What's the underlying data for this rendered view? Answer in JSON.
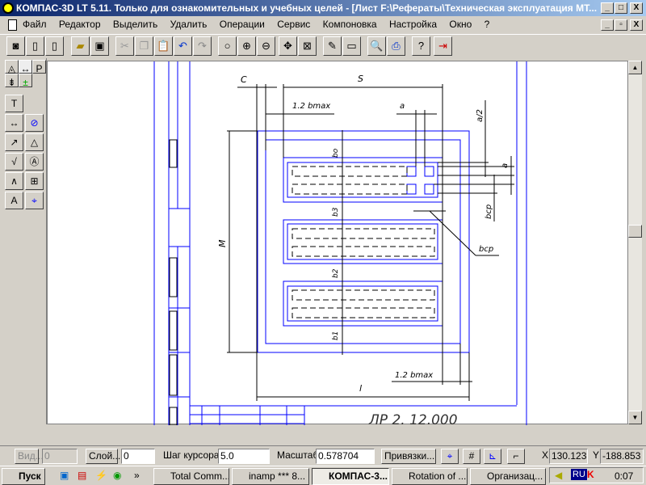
{
  "window": {
    "title": "КОМПАС-3D LT 5.11. Только для ознакомительных и учебных целей - [Лист F:\\Рефераты\\Техническая эксплуатация МТ...",
    "minimize": "_",
    "maximize": "□",
    "close": "X",
    "doc_restore": "▫"
  },
  "menu": [
    "Файл",
    "Редактор",
    "Выделить",
    "Удалить",
    "Операции",
    "Сервис",
    "Компоновка",
    "Настройка",
    "Окно",
    "?"
  ],
  "toolbar": [
    "new-document",
    "new-sheet",
    "new-fragment",
    "open",
    "save",
    "cut",
    "copy",
    "paste",
    "undo",
    "redo",
    "zoom",
    "zoom-in",
    "zoom-out",
    "pan",
    "fit",
    "pen",
    "table",
    "preview",
    "print",
    "help",
    "exit"
  ],
  "drawing": {
    "labels": {
      "c": "C",
      "s": "S",
      "bmax_top": "1.2 bmax",
      "a_top": "a",
      "a_half": "a/2",
      "a_right": "a",
      "b_o": "bo",
      "b3": "b3",
      "b2": "b2",
      "b1": "b1",
      "M": "M",
      "bcp_v": "bcp",
      "bcp": "bcp",
      "bmax_bottom": "1.2 bmax",
      "l": "l"
    },
    "stamp": "ЛР 2. 12.000",
    "line_color": "#0000ff"
  },
  "status": {
    "view_label": "Вид...",
    "view_value": "0",
    "layer_label": "Слой...",
    "layer_value": "0",
    "step_label": "Шаг курсора",
    "step_value": "5.0",
    "scale_label": "Масштаб",
    "scale_value": "0.578704",
    "snap_label": "Привязки...",
    "x_label": "X",
    "x_value": "130.123",
    "y_label": "Y",
    "y_value": "-188.853"
  },
  "taskbar": {
    "start": "Пуск",
    "more": "»",
    "tasks": [
      "Total Comm...",
      "inamp *** 8...",
      "КОМПАС-3...",
      "Rotation of ...",
      "Организац..."
    ],
    "lang": "RU",
    "clock": "0:07"
  }
}
